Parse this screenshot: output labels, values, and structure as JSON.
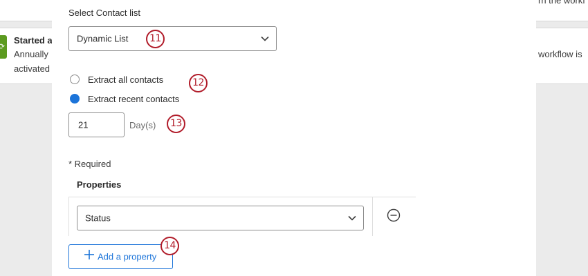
{
  "background": {
    "workflow_title": "Started a",
    "workflow_line1": "Annually",
    "workflow_line2": "activated",
    "right_top_text": "rn the workf",
    "right_mid_text": "workflow is"
  },
  "modal": {
    "contact_list": {
      "label": "Select Contact list",
      "selected": "Dynamic List",
      "badge": "11"
    },
    "extract": {
      "option_all": "Extract all contacts",
      "option_recent": "Extract recent contacts",
      "selected": "Extract recent contacts",
      "badge": "12"
    },
    "days": {
      "value": "21",
      "unit": "Day(s)",
      "badge": "13"
    },
    "required_note": "* Required",
    "properties": {
      "header": "Properties",
      "rows": [
        {
          "selected": "Status"
        }
      ]
    },
    "add_property": {
      "label": "Add a property",
      "badge": "14"
    }
  },
  "colors": {
    "accent": "#1c74d9",
    "badge": "#b11c2a",
    "workflow_icon": "#5b9a1f"
  }
}
